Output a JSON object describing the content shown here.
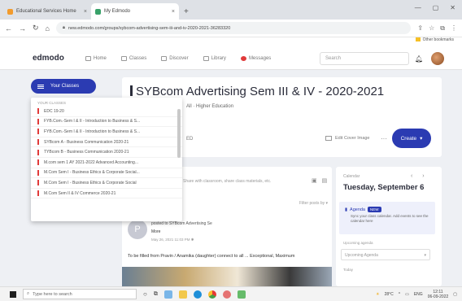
{
  "browser": {
    "tabs": [
      {
        "label": "Educational Services Home",
        "active": false,
        "color": "#f29b2d"
      },
      {
        "label": "My Edmodo",
        "active": true,
        "color": "#38a169"
      }
    ],
    "new_tab": "+",
    "url": "new.edmodo.com/groups/sybcom-advertising-sem-iii-and-iv-2020-2021-36283320",
    "bookmark": "Other bookmarks"
  },
  "nav": {
    "logo": "edmodo",
    "items": [
      "Home",
      "Classes",
      "Discover",
      "Library",
      "Messages"
    ],
    "search_placeholder": "Search"
  },
  "sidebar": {
    "your_classes": "Your Classes",
    "dropdown_header": "YOUR CLASSES",
    "items": [
      "EDC 19-20",
      "FYB.Com.-Sem I & II - Introduction to Business & S...",
      "FYB.Com.-Sem I & II - Introduction to Business & S...",
      "SYBcom A - Business Communication 2020-21",
      "TYBcom B - Business Communication 2020-21",
      "M.com sem 1 AY 2021-2022 Advanced Accounting...",
      "M.Com Sem I - Business Ethics & Corporate Social...",
      "M.Com Sem I - Business Ethics & Corporate Social",
      "M.Com Sem II & IV Commerce 2020-21"
    ]
  },
  "group": {
    "title": "SYBcom Advertising Sem III & IV - 2020-2021",
    "subtitle": "All · Higher Education",
    "edit_label": "Edit Cover Image",
    "more": "···",
    "create_label": "Create"
  },
  "feed": {
    "post_placeholder": "Share with classroom, share class materials, etc.",
    "filter_label": "Filter posts by",
    "post": {
      "avatar_letter": "P",
      "meta": "posted to SYBcom Advertising Se",
      "author": "More",
      "date": "May 26, 2021 11:03 PM",
      "text": "To be filled from Pravin / Anamika (daughter) connect to all ... Exceptional, Maximum"
    }
  },
  "calendar": {
    "label": "Calendar",
    "nav": "‹ ›",
    "date": "Tuesday, September 6",
    "agenda_title": "Agenda",
    "agenda_badge": "NEW",
    "agenda_text": "Sync your class calendar. Add events to see the calendar here",
    "sub_label": "Upcoming agenda",
    "select_label": "Upcoming Agenda",
    "sub_label2": "Today"
  },
  "taskbar": {
    "search_placeholder": "Type here to search",
    "temperature": "28°C",
    "time": "12:11",
    "date": "06-09-2022",
    "lang": "ENG"
  }
}
